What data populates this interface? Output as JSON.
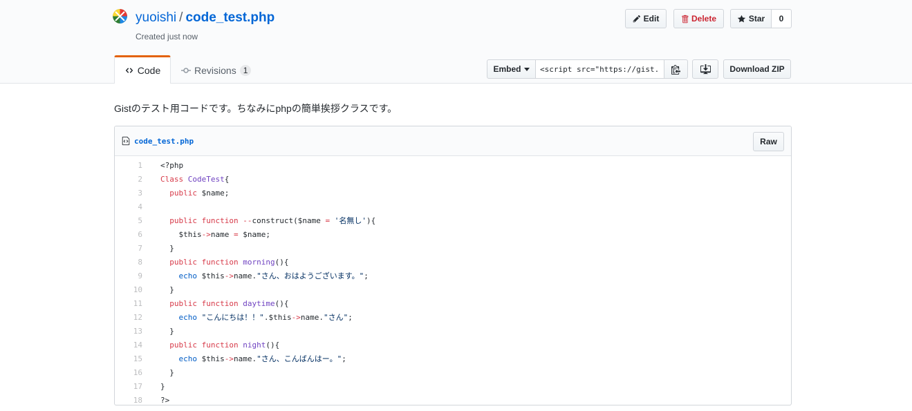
{
  "header": {
    "owner": "yuoishi",
    "separator": "/",
    "gist_name": "code_test.php",
    "created": "Created just now",
    "edit_label": "Edit",
    "delete_label": "Delete",
    "star_label": "Star",
    "star_count": "0"
  },
  "tabs": {
    "code_label": "Code",
    "revisions_label": "Revisions",
    "revisions_count": "1"
  },
  "embed": {
    "button_label": "Embed",
    "value": "<script src=\"https://gist.",
    "download_zip_label": "Download ZIP"
  },
  "description": "Gistのテスト用コードです。ちなみにphpの簡単挨拶クラスです。",
  "file": {
    "name": "code_test.php",
    "raw_label": "Raw",
    "lines": [
      {
        "n": "1",
        "t": [
          [
            "",
            "<?php"
          ]
        ]
      },
      {
        "n": "2",
        "t": [
          [
            "k",
            "Class"
          ],
          [
            "",
            " "
          ],
          [
            "e",
            "CodeTest"
          ],
          [
            "",
            "{"
          ]
        ]
      },
      {
        "n": "3",
        "t": [
          [
            "",
            "  "
          ],
          [
            "k",
            "public"
          ],
          [
            "",
            " $name;"
          ]
        ]
      },
      {
        "n": "4",
        "t": [
          [
            "",
            ""
          ]
        ]
      },
      {
        "n": "5",
        "t": [
          [
            "",
            "  "
          ],
          [
            "k",
            "public"
          ],
          [
            "",
            " "
          ],
          [
            "k",
            "function"
          ],
          [
            "",
            " "
          ],
          [
            "k",
            "--"
          ],
          [
            "",
            "construct($name "
          ],
          [
            "k",
            "="
          ],
          [
            "",
            " "
          ],
          [
            "s",
            "'名無し'"
          ],
          [
            "",
            "){"
          ]
        ]
      },
      {
        "n": "6",
        "t": [
          [
            "",
            "    $this"
          ],
          [
            "k",
            "->"
          ],
          [
            "",
            "name "
          ],
          [
            "k",
            "="
          ],
          [
            "",
            " $name;"
          ]
        ]
      },
      {
        "n": "7",
        "t": [
          [
            "",
            "  }"
          ]
        ]
      },
      {
        "n": "8",
        "t": [
          [
            "",
            "  "
          ],
          [
            "k",
            "public"
          ],
          [
            "",
            " "
          ],
          [
            "k",
            "function"
          ],
          [
            "",
            " "
          ],
          [
            "e",
            "morning"
          ],
          [
            "",
            "(){"
          ]
        ]
      },
      {
        "n": "9",
        "t": [
          [
            "",
            "    "
          ],
          [
            "c1",
            "echo"
          ],
          [
            "",
            " $this"
          ],
          [
            "k",
            "->"
          ],
          [
            "",
            "name."
          ],
          [
            "s",
            "\"さん、おはようございます。\""
          ],
          [
            "",
            ";"
          ]
        ]
      },
      {
        "n": "10",
        "t": [
          [
            "",
            "  }"
          ]
        ]
      },
      {
        "n": "11",
        "t": [
          [
            "",
            "  "
          ],
          [
            "k",
            "public"
          ],
          [
            "",
            " "
          ],
          [
            "k",
            "function"
          ],
          [
            "",
            " "
          ],
          [
            "e",
            "daytime"
          ],
          [
            "",
            "(){"
          ]
        ]
      },
      {
        "n": "12",
        "t": [
          [
            "",
            "    "
          ],
          [
            "c1",
            "echo"
          ],
          [
            "",
            " "
          ],
          [
            "s",
            "\"こんにちは！！\""
          ],
          [
            "",
            ".$this"
          ],
          [
            "k",
            "->"
          ],
          [
            "",
            "name."
          ],
          [
            "s",
            "\"さん\""
          ],
          [
            "",
            ";"
          ]
        ]
      },
      {
        "n": "13",
        "t": [
          [
            "",
            "  }"
          ]
        ]
      },
      {
        "n": "14",
        "t": [
          [
            "",
            "  "
          ],
          [
            "k",
            "public"
          ],
          [
            "",
            " "
          ],
          [
            "k",
            "function"
          ],
          [
            "",
            " "
          ],
          [
            "e",
            "night"
          ],
          [
            "",
            "(){"
          ]
        ]
      },
      {
        "n": "15",
        "t": [
          [
            "",
            "    "
          ],
          [
            "c1",
            "echo"
          ],
          [
            "",
            " $this"
          ],
          [
            "k",
            "->"
          ],
          [
            "",
            "name."
          ],
          [
            "s",
            "\"さん、こんばんはー。\""
          ],
          [
            "",
            ";"
          ]
        ]
      },
      {
        "n": "16",
        "t": [
          [
            "",
            "  }"
          ]
        ]
      },
      {
        "n": "17",
        "t": [
          [
            "",
            "}"
          ]
        ]
      },
      {
        "n": "18",
        "t": [
          [
            "",
            "?>"
          ]
        ]
      }
    ]
  },
  "colors": {
    "link": "#0366d6",
    "tab_accent": "#e36209",
    "delete": "#cb2431",
    "keyword": "#d73a49",
    "entity": "#6f42c1",
    "constant": "#005cc5",
    "string": "#032f62"
  },
  "icons": [
    "avatar",
    "pencil-icon",
    "trash-icon",
    "star-icon",
    "code-icon",
    "commit-icon",
    "caret-down-icon",
    "clippy-icon",
    "desktop-download-icon",
    "file-code-icon"
  ]
}
